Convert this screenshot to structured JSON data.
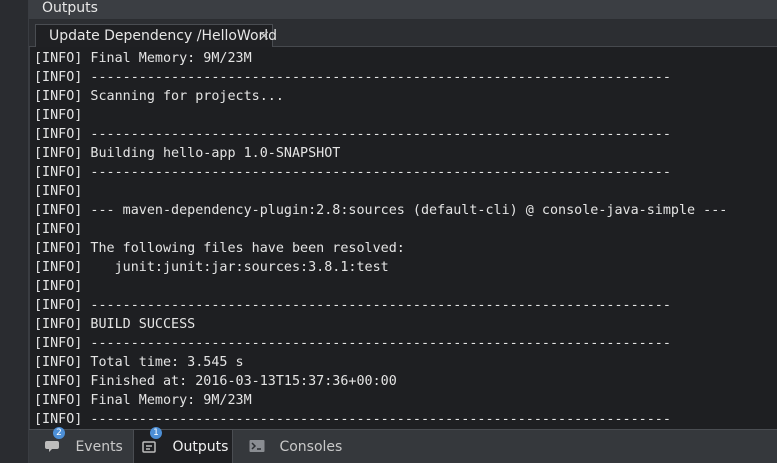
{
  "panel": {
    "title": "Outputs"
  },
  "output_tab": {
    "label": "Update Dependency /HelloWorld",
    "close_glyph": "×"
  },
  "console": {
    "lines": [
      "[INFO] Final Memory: 9M/23M",
      "[INFO] ------------------------------------------------------------------------",
      "[INFO] Scanning for projects...",
      "[INFO]",
      "[INFO] ------------------------------------------------------------------------",
      "[INFO] Building hello-app 1.0-SNAPSHOT",
      "[INFO] ------------------------------------------------------------------------",
      "[INFO]",
      "[INFO] --- maven-dependency-plugin:2.8:sources (default-cli) @ console-java-simple ---",
      "[INFO]",
      "[INFO] The following files have been resolved:",
      "[INFO]    junit:junit:jar:sources:3.8.1:test",
      "[INFO]",
      "[INFO] ------------------------------------------------------------------------",
      "[INFO] BUILD SUCCESS",
      "[INFO] ------------------------------------------------------------------------",
      "[INFO] Total time: 3.545 s",
      "[INFO] Finished at: 2016-03-13T15:37:36+00:00",
      "[INFO] Final Memory: 9M/23M",
      "[INFO] ------------------------------------------------------------------------"
    ]
  },
  "bottom_tabs": [
    {
      "label": "Events",
      "badge": "2",
      "icon": "speech-bubble-icon",
      "active": false
    },
    {
      "label": "Outputs",
      "badge": "1",
      "icon": "output-icon",
      "active": true
    },
    {
      "label": "Consoles",
      "badge": "",
      "icon": "terminal-icon",
      "active": false
    }
  ],
  "colors": {
    "accent": "#4d8fd6",
    "console_bg": "#1e1f22",
    "console_text": "#e4e4e4",
    "header_bg": "#3b3e43"
  }
}
